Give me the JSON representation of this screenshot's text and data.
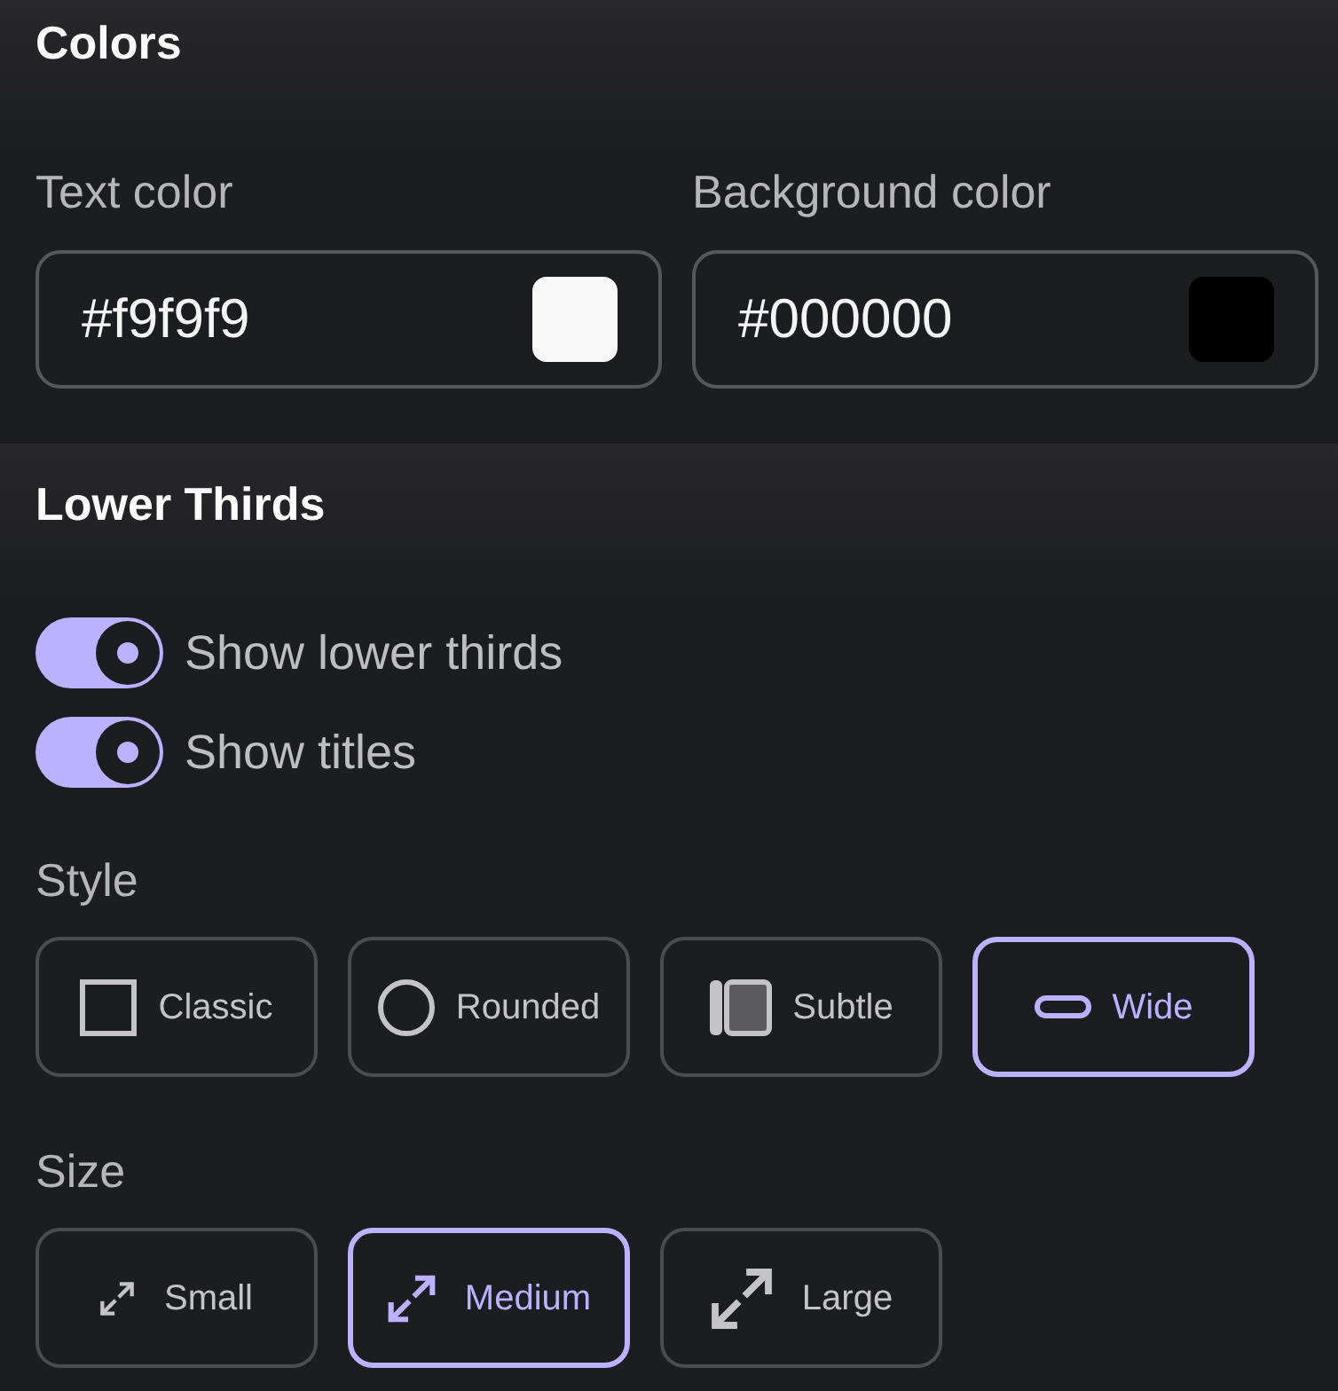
{
  "colors": {
    "title": "Colors",
    "fields": [
      {
        "label": "Text color",
        "value": "#f9f9f9",
        "color": "#f9f9f9"
      },
      {
        "label": "Background color",
        "value": "#000000",
        "color": "#000000"
      }
    ]
  },
  "lower_thirds": {
    "title": "Lower Thirds",
    "toggles": [
      {
        "label": "Show lower thirds",
        "on": true
      },
      {
        "label": "Show titles",
        "on": true
      }
    ],
    "style": {
      "label": "Style",
      "options": [
        {
          "label": "Classic",
          "kind": "square",
          "selected": false
        },
        {
          "label": "Rounded",
          "kind": "circle",
          "selected": false
        },
        {
          "label": "Subtle",
          "kind": "panel",
          "selected": false
        },
        {
          "label": "Wide",
          "kind": "pill",
          "selected": true
        }
      ]
    },
    "size": {
      "label": "Size",
      "options": [
        {
          "label": "Small",
          "kind": "small",
          "selected": false
        },
        {
          "label": "Medium",
          "kind": "medium",
          "selected": true
        },
        {
          "label": "Large",
          "kind": "large",
          "selected": false
        }
      ]
    }
  }
}
